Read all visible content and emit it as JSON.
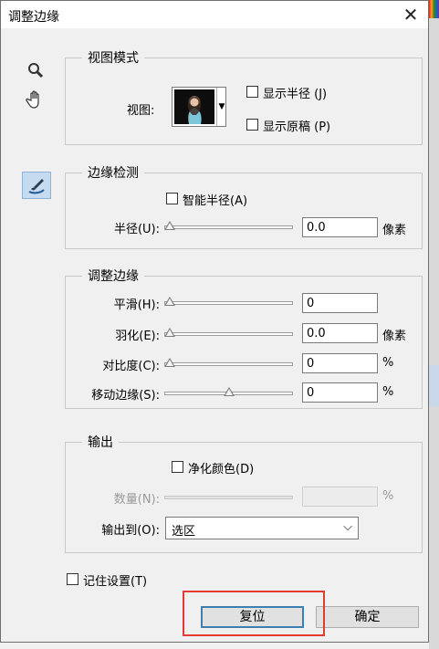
{
  "dialog": {
    "title": "调整边缘",
    "close_icon": "close-icon"
  },
  "tools": [
    {
      "name": "zoom-tool",
      "icon": "magnifier-icon"
    },
    {
      "name": "hand-tool",
      "icon": "hand-icon"
    },
    {
      "name": "refine-radius-tool",
      "icon": "brush-icon",
      "active": true
    }
  ],
  "view_mode": {
    "legend": "视图模式",
    "view_label": "视图:",
    "show_radius": "显示半径 (J)",
    "show_original": "显示原稿 (P)"
  },
  "edge_detection": {
    "legend": "边缘检测",
    "smart_radius": "智能半径(A)",
    "radius_label": "半径(U):",
    "radius_value": "0.0",
    "radius_unit": "像素",
    "radius_level": 0
  },
  "adjust_edge": {
    "legend": "调整边缘",
    "smooth_label": "平滑(H):",
    "smooth_value": "0",
    "smooth_level": 0,
    "feather_label": "羽化(E):",
    "feather_value": "0.0",
    "feather_unit": "像素",
    "feather_level": 0,
    "contrast_label": "对比度(C):",
    "contrast_value": "0",
    "contrast_unit": "%",
    "contrast_level": 0,
    "shift_label": "移动边缘(S):",
    "shift_value": "0",
    "shift_unit": "%",
    "shift_level": 0.5
  },
  "output": {
    "legend": "输出",
    "decontaminate": "净化颜色(D)",
    "amount_label": "数量(N):",
    "amount_unit": "%",
    "output_to_label": "输出到(O):",
    "output_to_value": "选区"
  },
  "remember": "记住设置(T)",
  "buttons": {
    "reset": "复位",
    "ok": "确定"
  },
  "colors": {
    "highlight": "#e53935",
    "default_button_border": "#3c7fb1",
    "active_tool": "#c6daf0"
  }
}
